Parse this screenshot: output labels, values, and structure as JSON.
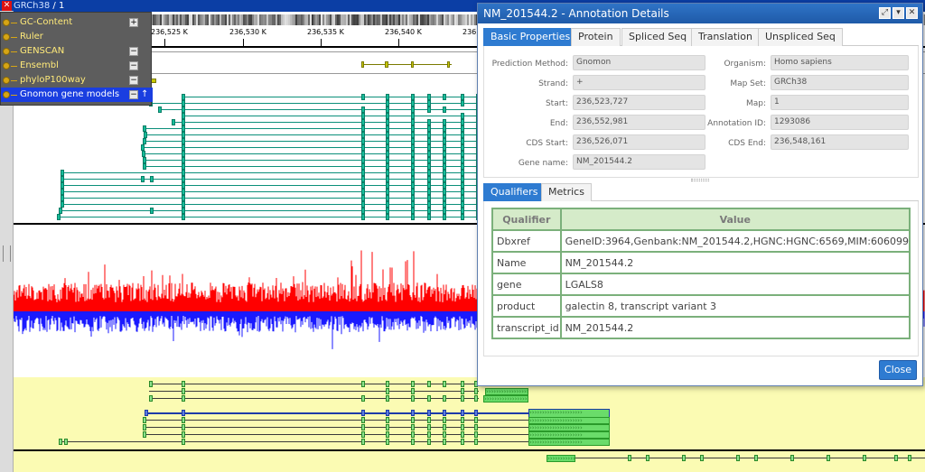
{
  "browser": {
    "assembly": "GRCh38",
    "chromosome": "1"
  },
  "ruler": {
    "ticks": [
      "236,525 K",
      "236,530 K",
      "236,535 K",
      "236,540 K",
      "236,5"
    ]
  },
  "tracks": [
    {
      "label": "GC-Content",
      "toggle": "+"
    },
    {
      "label": "Ruler",
      "toggle": ""
    },
    {
      "label": "GENSCAN",
      "toggle": "−"
    },
    {
      "label": "Ensembl",
      "toggle": "−"
    },
    {
      "label": "phyloP100way",
      "toggle": "−"
    },
    {
      "label": "Gnomon gene models",
      "toggle": "−"
    }
  ],
  "dialog": {
    "title": "NM_201544.2 - Annotation Details",
    "tabs": [
      "Basic Properties",
      "Protein",
      "Spliced Seq",
      "Translation",
      "Unspliced Seq"
    ],
    "props_left": [
      {
        "label": "Prediction Method:",
        "value": "Gnomon"
      },
      {
        "label": "Strand:",
        "value": "+"
      },
      {
        "label": "Start:",
        "value": "236,523,727"
      },
      {
        "label": "End:",
        "value": "236,552,981"
      },
      {
        "label": "CDS Start:",
        "value": "236,526,071"
      },
      {
        "label": "Gene name:",
        "value": "NM_201544.2"
      }
    ],
    "props_right": [
      {
        "label": "Organism:",
        "value": "Homo sapiens"
      },
      {
        "label": "Map Set:",
        "value": "GRCh38"
      },
      {
        "label": "Map:",
        "value": "1"
      },
      {
        "label": "Annotation ID:",
        "value": "1293086"
      },
      {
        "label": "CDS End:",
        "value": "236,548,161"
      }
    ],
    "sub_tabs": [
      "Qualifiers",
      "Metrics"
    ],
    "qualifiers": {
      "headers": [
        "Qualifier",
        "Value"
      ],
      "rows": [
        [
          "Dbxref",
          "GeneID:3964,Genbank:NM_201544.2,HGNC:HGNC:6569,MIM:606099"
        ],
        [
          "Name",
          "NM_201544.2"
        ],
        [
          "gene",
          "LGALS8"
        ],
        [
          "product",
          "galectin 8, transcript variant 3"
        ],
        [
          "transcript_id",
          "NM_201544.2"
        ]
      ]
    },
    "close_label": "Close"
  },
  "colors": {
    "title_blue": "#0b3ea5",
    "accent_blue": "#2e7bd1",
    "gene_teal": "#16bd9a",
    "plus_red": "#ff0000",
    "minus_blue": "#1a1aff",
    "highlight_yellow": "#fbfbb3"
  }
}
